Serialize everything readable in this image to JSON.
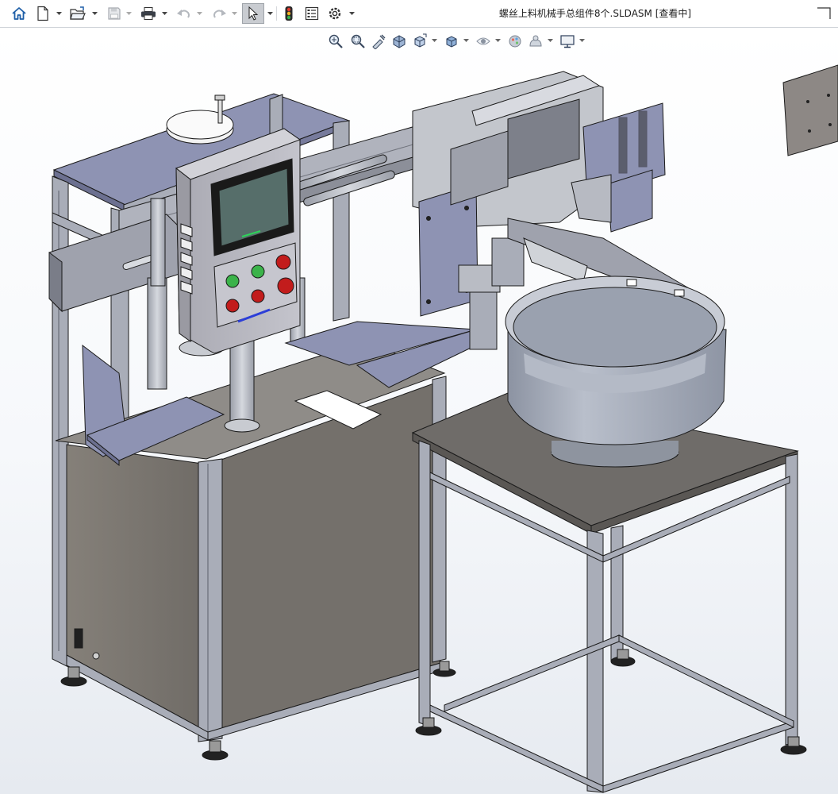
{
  "window": {
    "title": "螺丝上料机械手总组件8个.SLDASM [查看中]"
  },
  "toolbar": {
    "items": [
      {
        "name": "home-icon",
        "tooltip": ""
      },
      {
        "name": "new-document-icon"
      },
      {
        "name": "open-folder-icon"
      },
      {
        "name": "save-icon"
      },
      {
        "name": "print-icon"
      },
      {
        "name": "undo-icon"
      },
      {
        "name": "redo-icon"
      },
      {
        "name": "select-arrow-icon"
      },
      {
        "name": "rebuild-traffic-light-icon"
      },
      {
        "name": "file-properties-icon"
      },
      {
        "name": "options-gear-icon"
      }
    ]
  },
  "view_toolbar": {
    "items": [
      {
        "name": "zoom-to-fit-icon"
      },
      {
        "name": "zoom-to-area-icon"
      },
      {
        "name": "previous-view-icon"
      },
      {
        "name": "section-view-icon"
      },
      {
        "name": "view-orientation-icon"
      },
      {
        "name": "display-style-icon"
      },
      {
        "name": "hide-show-items-icon"
      },
      {
        "name": "edit-appearance-icon"
      },
      {
        "name": "apply-scene-icon"
      },
      {
        "name": "view-settings-icon"
      }
    ]
  },
  "colors": {
    "frame_profile": "#a9adb8",
    "plate_blue": "#8e93b3",
    "cabinet_panel": "#7c7873",
    "table_top": "#6f6c69",
    "bowl": "#a0a7b6",
    "screen": "#566e6a",
    "button_green": "#3bb34a",
    "button_red": "#c21c1c",
    "edge": "#1b1b1b"
  }
}
